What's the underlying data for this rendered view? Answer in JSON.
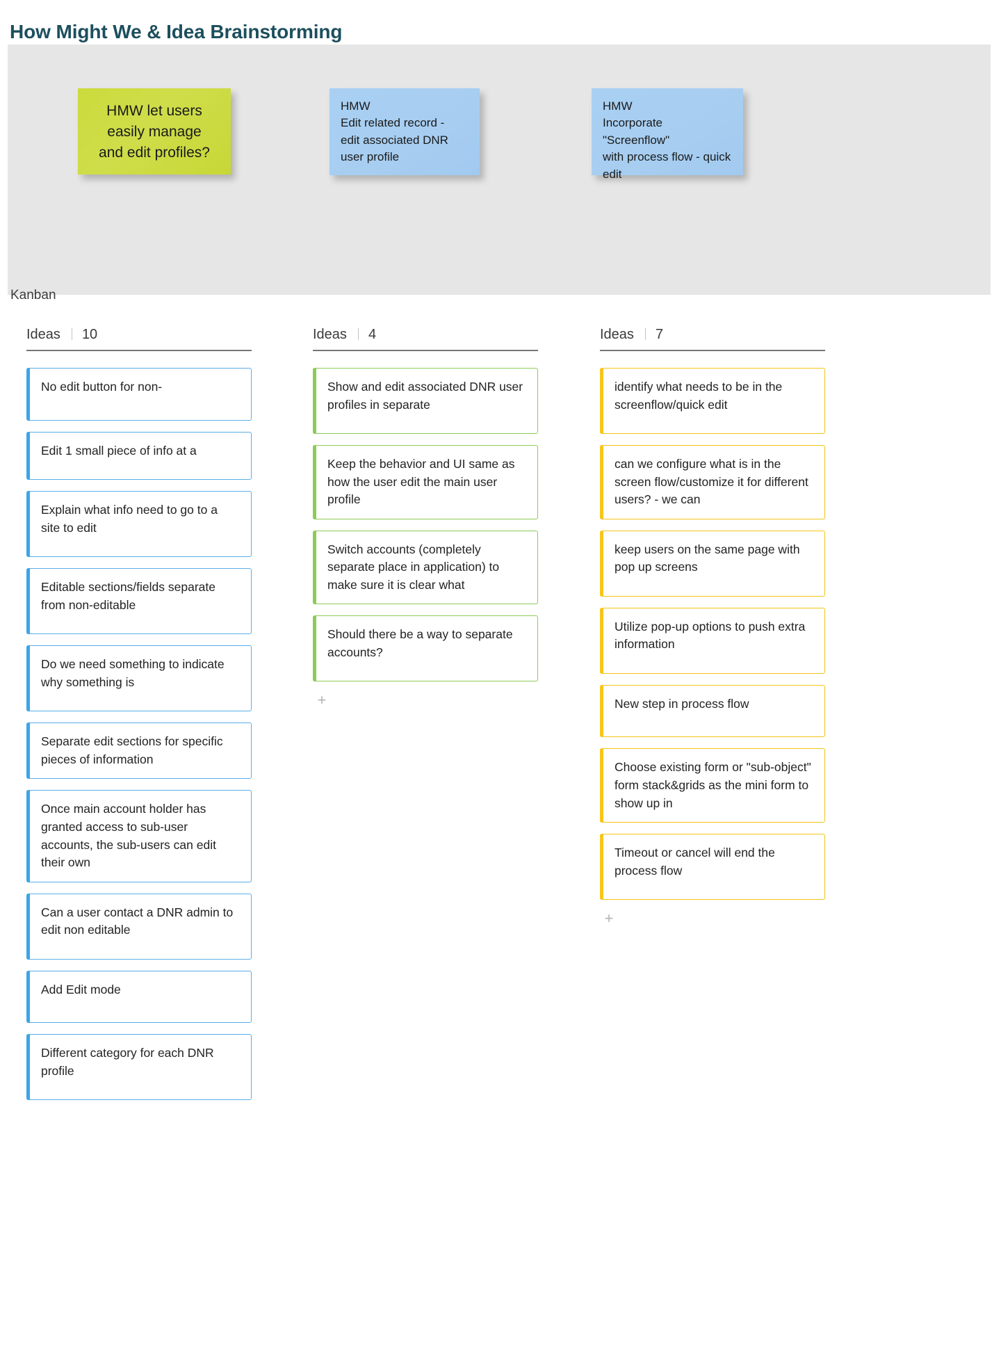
{
  "page": {
    "title": "How Might We & Idea Brainstorming",
    "kanban_label": "Kanban"
  },
  "colors": {
    "title": "#1d4f5e",
    "board_background": "#e6e6e6",
    "sticky_green": "#cbdb3c",
    "sticky_blue": "#a9d0f2",
    "accent_blue": "#3da5e8",
    "accent_green": "#8dcb57",
    "accent_yellow": "#f7c51c"
  },
  "hmw_board": {
    "notes": [
      {
        "color": "green",
        "lines": [
          "HMW let users",
          "easily manage",
          "and edit profiles?"
        ]
      },
      {
        "color": "blue",
        "lines": [
          "HMW",
          "Edit  related record -",
          "edit associated DNR",
          "user profile"
        ]
      },
      {
        "color": "blue",
        "lines": [
          "HMW",
          "Incorporate \"Screenflow\"",
          "with process flow - quick",
          "edit"
        ]
      }
    ]
  },
  "kanban": {
    "columns": [
      {
        "name": "Ideas",
        "count": "10",
        "accent": "blue",
        "add_label": "+",
        "has_add": false,
        "cards": [
          {
            "text": "No edit button for non-"
          },
          {
            "text": "Edit 1 small piece of info at a"
          },
          {
            "text": "Explain what info need to go to a site to edit"
          },
          {
            "text": "Editable sections/fields separate from non-editable"
          },
          {
            "text": "Do we need something to indicate why something is"
          },
          {
            "text": "Separate edit sections for specific pieces of information"
          },
          {
            "text": "Once main account holder has granted access to sub-user accounts, the sub-users can edit their own"
          },
          {
            "text": "Can a user contact a DNR admin to edit non editable"
          },
          {
            "text": "Add Edit mode"
          },
          {
            "text": "Different category for each DNR profile"
          }
        ]
      },
      {
        "name": "Ideas",
        "count": "4",
        "accent": "green",
        "add_label": "+",
        "has_add": true,
        "cards": [
          {
            "text": "Show and edit associated DNR user profiles in separate"
          },
          {
            "text": "Keep the behavior and UI same as how the user edit the main user profile"
          },
          {
            "text": "Switch accounts (completely separate place in application) to make sure it is clear what"
          },
          {
            "text": "Should there be a way to separate accounts?"
          }
        ]
      },
      {
        "name": "Ideas",
        "count": "7",
        "accent": "yellow",
        "add_label": "+",
        "has_add": true,
        "cards": [
          {
            "text": "identify what needs to be in the screenflow/quick edit"
          },
          {
            "text": "can we configure what is in the screen flow/customize it for different users? - we can"
          },
          {
            "text": "keep users on the same page with pop up screens"
          },
          {
            "text": "Utilize pop-up options to push extra information"
          },
          {
            "text": "New step in process flow"
          },
          {
            "text": "Choose existing form or \"sub-object\" form stack&grids as the mini form to show up in"
          },
          {
            "text": "Timeout or cancel will end the process flow"
          }
        ]
      }
    ]
  }
}
